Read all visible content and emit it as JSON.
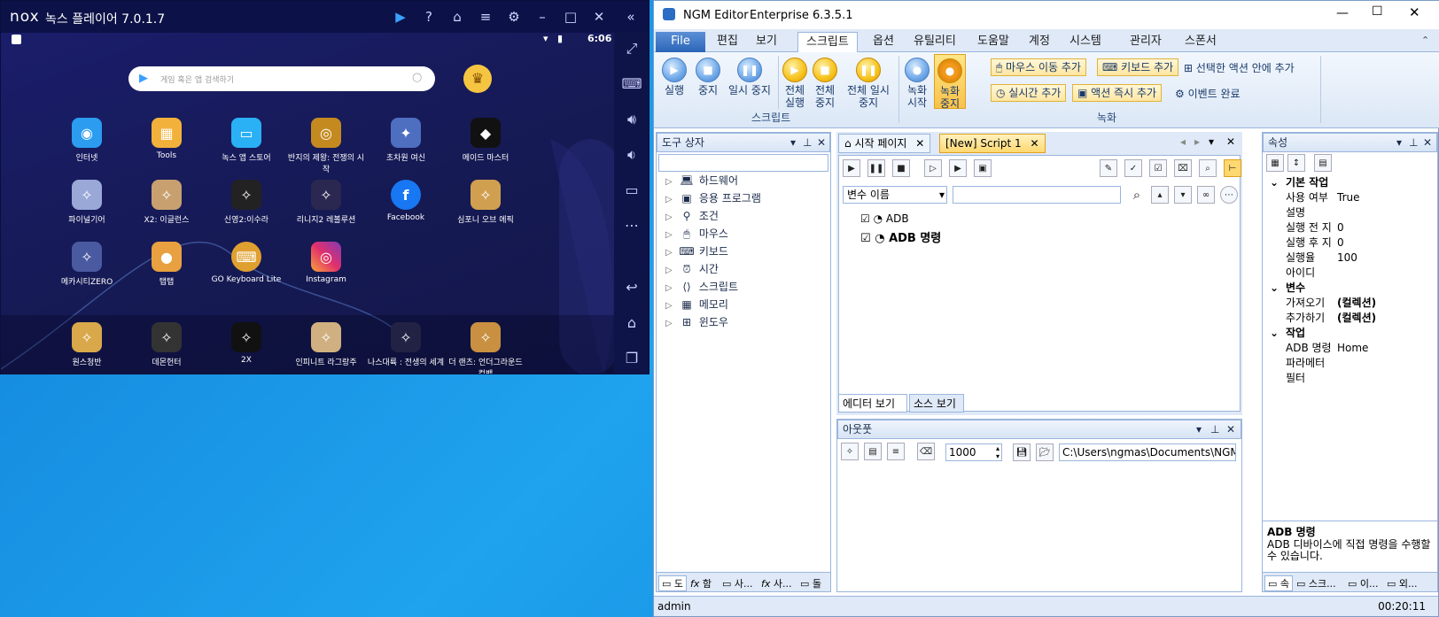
{
  "nox": {
    "logo": "nox",
    "title": "녹스 플레이어 7.0.1.7",
    "time": "6:06",
    "search_placeholder": "게임 혹은 앱 검색하기",
    "apps_row1": [
      "인터넷",
      "Tools",
      "녹스 앱 스토어",
      "반지의 제왕: 전쟁의 시작",
      "초차원 여신",
      "메이드 마스터"
    ],
    "apps_row2": [
      "파이널기어",
      "X2: 이글런스",
      "신영2:이수라",
      "리니지2 레볼루션",
      "Facebook",
      "심포니 오브 에픽"
    ],
    "apps_row3": [
      "메카시티ZERO",
      "탭탭",
      "GO Keyboard Lite",
      "Instagram"
    ],
    "dock": [
      "원스청반",
      "데몬헌터",
      "2X",
      "인피니트 라그랑주",
      "나스대륙 : 전생의 세계",
      "더 랜츠: 언더그라운드 컴뱃"
    ],
    "colors": {
      "title_bar": "#0c1247",
      "screen": "#161a55"
    }
  },
  "ngm": {
    "app_name": "NGM Editor",
    "edition": "Enterprise 6.3.5.1",
    "tabs": [
      "File",
      "편집",
      "보기",
      "스크립트",
      "옵션",
      "유틸리티",
      "도움말",
      "계정",
      "시스템",
      "관리자",
      "스폰서"
    ],
    "active_tab": "스크립트",
    "ribbon": {
      "run": "실행",
      "stop": "중지",
      "pause": "일시 중지",
      "run_all": "전체 실행",
      "stop_all": "전체 중지",
      "pause_all": "전체 일시 중지",
      "group_script": "스크립트",
      "rec_start": "녹화 시작",
      "rec_stop": "녹화 중지",
      "add_mouse": "마우스 이동 추가",
      "add_keyboard": "키보드 추가",
      "add_selected": "선택한 액션 안에 추가",
      "add_realtime": "실시간 추가",
      "add_action_now": "액션 즉시 추가",
      "event_done": "이벤트 완료",
      "group_record": "녹화"
    },
    "toolbox": {
      "title": "도구 상자",
      "items": [
        "하드웨어",
        "응용 프로그램",
        "조건",
        "마우스",
        "키보드",
        "시간",
        "스크립트",
        "메모리",
        "윈도우"
      ],
      "bottom_tabs": [
        "도",
        "함",
        "사...",
        "사...",
        "돌"
      ]
    },
    "editor": {
      "tabs": [
        "시작 페이지",
        "[New] Script 1"
      ],
      "var_name": "변수 이름",
      "nodes": [
        "ADB",
        "ADB 명령"
      ],
      "bottom_tabs": [
        "에디터 보기",
        "소스 보기"
      ]
    },
    "output": {
      "title": "아웃풋",
      "count": "1000",
      "path": "C:\\Users\\ngmas\\Documents\\NGM6\\"
    },
    "properties": {
      "title": "속성",
      "cat1": "기본 작업",
      "rows1": [
        [
          "사용 여부",
          "True"
        ],
        [
          "설명",
          ""
        ],
        [
          "실행 전 지",
          "0"
        ],
        [
          "실행 후 지",
          "0"
        ],
        [
          "실행율",
          "100"
        ],
        [
          "아이디",
          ""
        ]
      ],
      "cat2": "변수",
      "rows2": [
        [
          "가져오기",
          "(컬렉션)"
        ],
        [
          "추가하기",
          "(컬렉션)"
        ]
      ],
      "cat3": "작업",
      "rows3": [
        [
          "ADB 명령",
          "Home"
        ],
        [
          "파라메터",
          ""
        ],
        [
          "필터",
          ""
        ]
      ],
      "desc_title": "ADB 명령",
      "desc_text": "ADB 디바이스에 직접 명령을 수행할 수 있습니다.",
      "bottom_tabs": [
        "속",
        "스크...",
        "이...",
        "외..."
      ]
    },
    "status": {
      "user": "admin",
      "time": "00:20:11"
    }
  }
}
